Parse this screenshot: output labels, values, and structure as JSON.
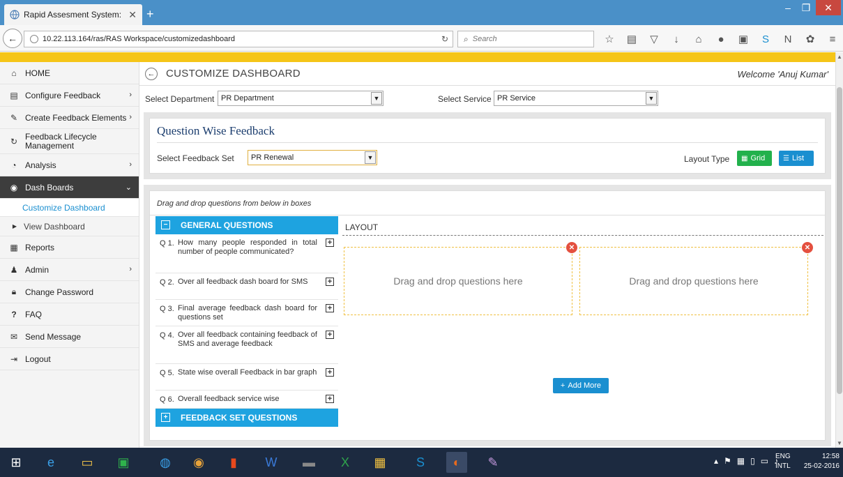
{
  "browser": {
    "tab_title": "Rapid Assesment System: ...",
    "url": "10.22.113.164/ras/RAS Workspace/customizedashboard",
    "search_placeholder": "Search"
  },
  "sidebar": {
    "items": [
      {
        "label": "HOME",
        "icon": "home-icon"
      },
      {
        "label": "Configure Feedback",
        "icon": "file-icon"
      },
      {
        "label": "Create Feedback Elements",
        "icon": "pencil-icon"
      },
      {
        "label": "Feedback Lifecycle Management",
        "icon": "refresh-icon"
      },
      {
        "label": "Analysis",
        "icon": "pie-chart-icon"
      },
      {
        "label": "Dash Boards",
        "icon": "dashboard-icon"
      },
      {
        "label": "Customize Dashboard"
      },
      {
        "label": "View Dashboard"
      },
      {
        "label": "Reports",
        "icon": "reports-icon"
      },
      {
        "label": "Admin",
        "icon": "user-icon"
      },
      {
        "label": "Change Password",
        "icon": "lock-icon"
      },
      {
        "label": "FAQ",
        "icon": "question-icon"
      },
      {
        "label": "Send Message",
        "icon": "envelope-icon"
      },
      {
        "label": "Logout",
        "icon": "logout-icon"
      }
    ]
  },
  "header": {
    "title": "CUSTOMIZE DASHBOARD",
    "welcome": "Welcome 'Anuj Kumar'"
  },
  "filters": {
    "department_label": "Select Department",
    "department_value": "PR Department",
    "service_label": "Select Service",
    "service_value": "PR Service"
  },
  "question_wise": {
    "title": "Question Wise Feedback",
    "feedback_set_label": "Select Feedback Set",
    "feedback_set_value": "PR Renewal",
    "layout_type_label": "Layout Type",
    "grid_label": "Grid",
    "list_label": "List"
  },
  "dnd": {
    "hint": "Drag and drop questions from below in boxes",
    "general_header": "GENERAL QUESTIONS",
    "feedback_set_header": "FEEDBACK SET QUESTIONS",
    "questions": [
      {
        "num": "Q 1.",
        "text": "How many people responded in total number of people communicated?"
      },
      {
        "num": "Q 2.",
        "text": "Over all feedback dash board for SMS"
      },
      {
        "num": "Q 3.",
        "text": "Final average feedback dash board for questions set"
      },
      {
        "num": "Q 4.",
        "text": "Over all feedback containing feedback of SMS and average feedback"
      },
      {
        "num": "Q 5.",
        "text": "State wise overall Feedback in bar graph"
      },
      {
        "num": "Q 6.",
        "text": "Overall feedback service wise"
      }
    ],
    "layout_label": "LAYOUT",
    "dropbox_text": "Drag and drop questions here",
    "add_more_label": "Add More"
  },
  "taskbar": {
    "lang_top": "ENG",
    "lang_bottom": "INTL",
    "time": "12:58",
    "date": "25-02-2016"
  },
  "colors": {
    "accent_blue": "#1ea3e0",
    "grid_green": "#22b14c",
    "header_yellow": "#f5c518",
    "sidebar_active": "#3d3d3d",
    "close_red": "#e4503f"
  }
}
